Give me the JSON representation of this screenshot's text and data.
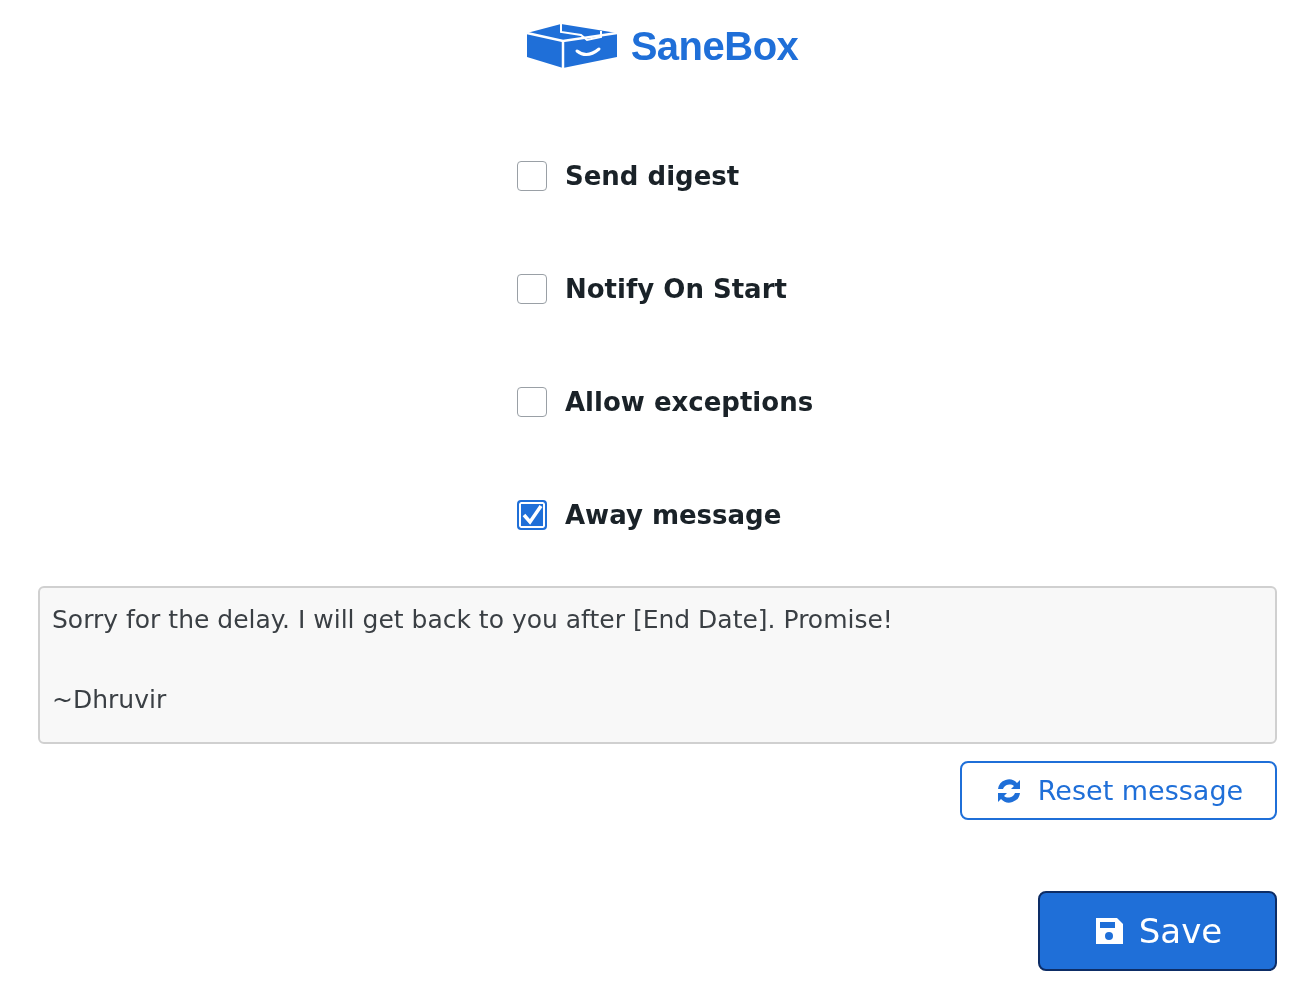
{
  "logo": {
    "text": "SaneBox"
  },
  "options": [
    {
      "label": "Send digest",
      "checked": false
    },
    {
      "label": "Notify On Start",
      "checked": false
    },
    {
      "label": "Allow exceptions",
      "checked": false
    },
    {
      "label": "Away message",
      "checked": true
    }
  ],
  "message": {
    "value": "Sorry for the delay. I will get back to you after [End Date]. Promise!\n\n~Dhruvir"
  },
  "reset_button": {
    "label": "Reset message"
  },
  "save_button": {
    "label": "Save"
  }
}
